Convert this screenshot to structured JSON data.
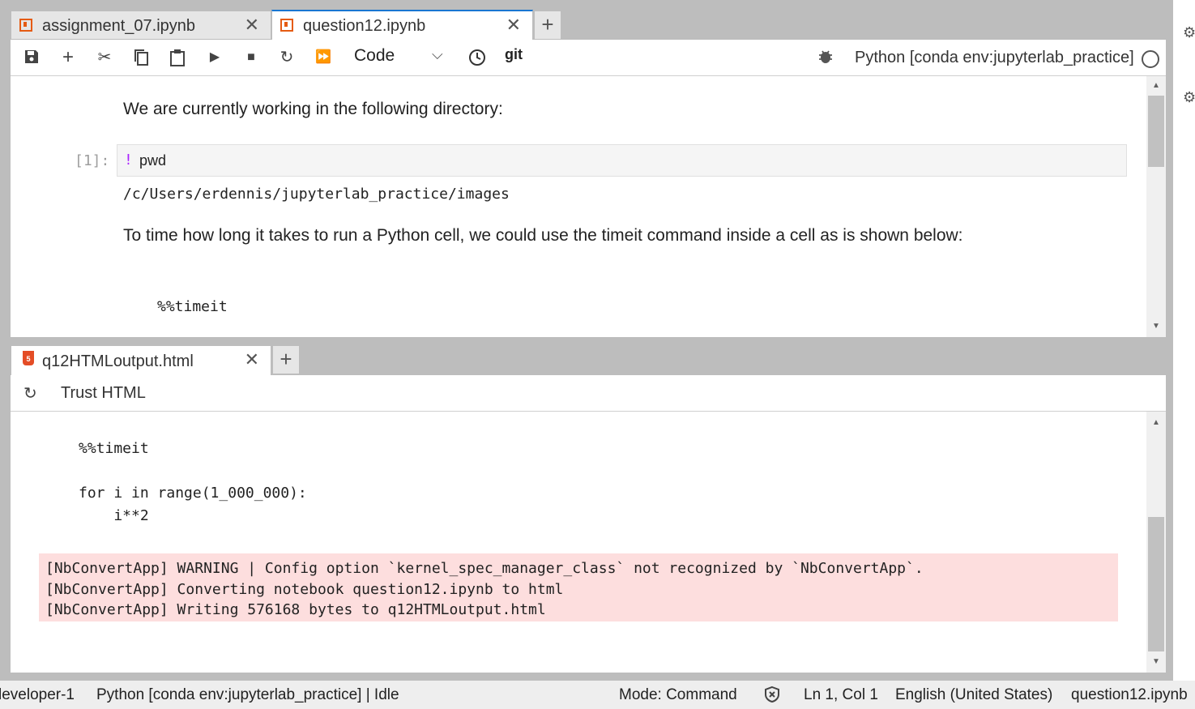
{
  "tabs": [
    {
      "label": "assignment_07.ipynb",
      "active": false
    },
    {
      "label": "question12.ipynb",
      "active": true
    }
  ],
  "toolbar": {
    "cell_type": "Code",
    "git_label": "git",
    "kernel_name": "Python [conda env:jupyterlab_practice]"
  },
  "notebook": {
    "md1": "We are currently working in the following directory:",
    "prompt": "[1]:",
    "bang": "!",
    "cmd": "pwd",
    "output": "/c/Users/erdennis/jupyterlab_practice/images",
    "md2": "To time how long it takes to run a Python cell, we could use the timeit command inside a cell as is shown below:",
    "code_snippet": "%%timeit"
  },
  "html_view": {
    "tab_label": "q12HTMLoutput.html",
    "trust_label": "Trust HTML",
    "code": "%%timeit\n\nfor i in range(1_000_000):\n    i**2",
    "stderr": "[NbConvertApp] WARNING | Config option `kernel_spec_manager_class` not recognized by `NbConvertApp`.\n[NbConvertApp] Converting notebook question12.ipynb to html\n[NbConvertApp] Writing 576168 bytes to q12HTMLoutput.html"
  },
  "statusbar": {
    "left": "leveloper-1",
    "kernel_status": "Python [conda env:jupyterlab_practice] | Idle",
    "mode": "Mode: Command",
    "position": "Ln 1, Col 1",
    "language": "English (United States)",
    "filename": "question12.ipynb"
  },
  "colors": {
    "accent": "#1976d2",
    "notebook_icon": "#e55b12",
    "stderr_bg": "#fddede"
  }
}
